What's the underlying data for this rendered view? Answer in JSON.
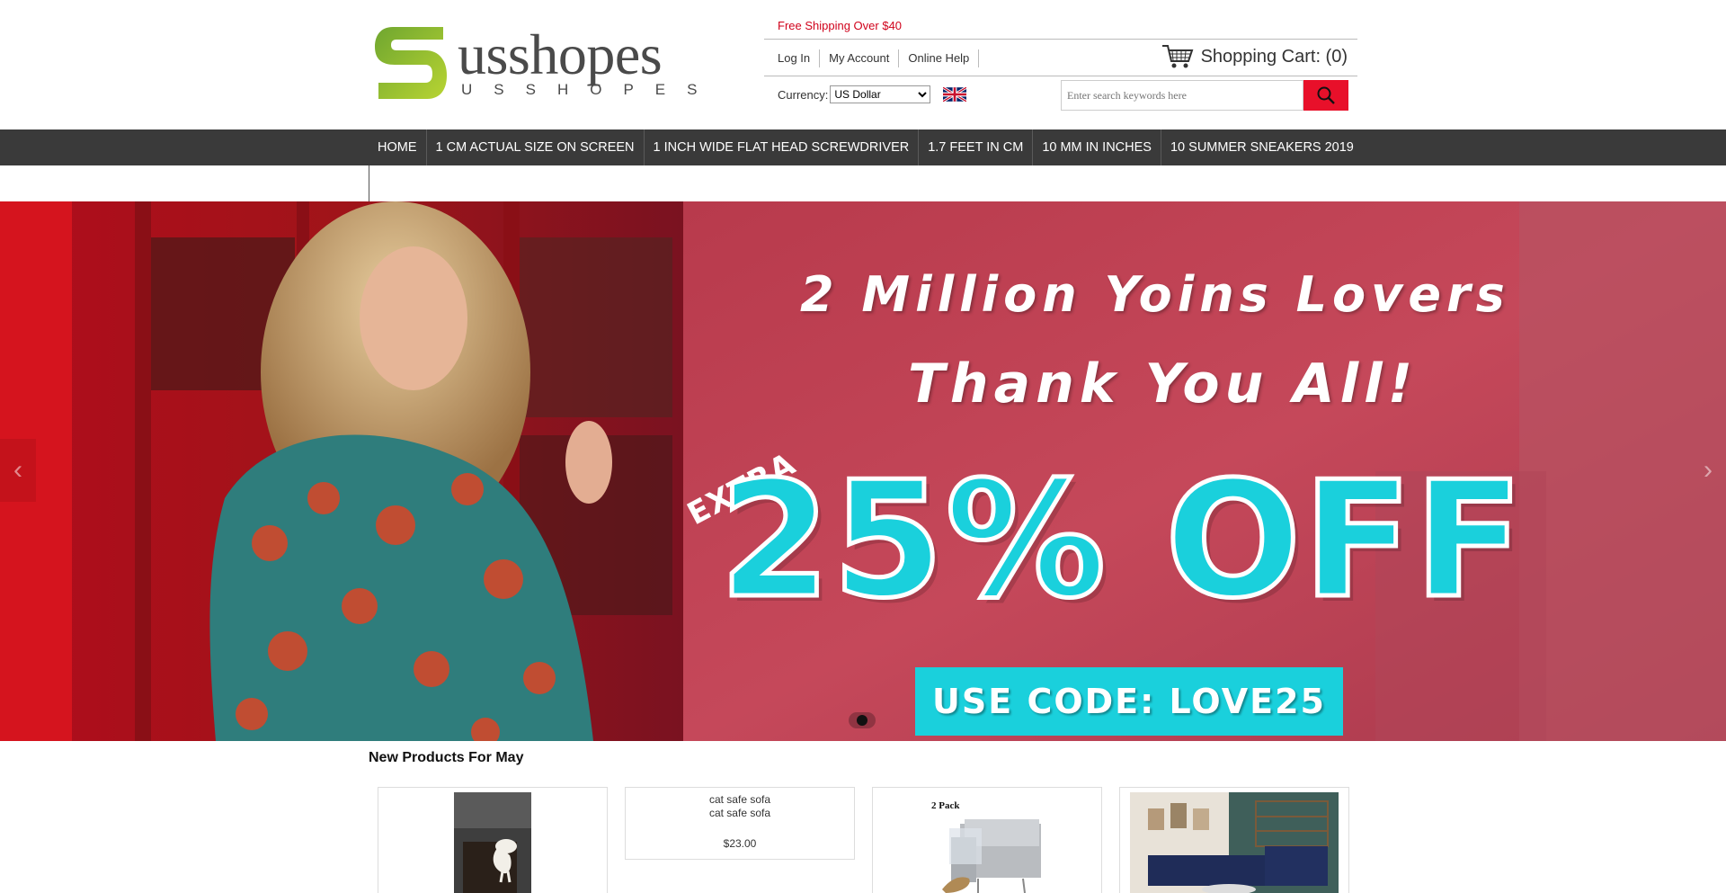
{
  "header": {
    "logo": {
      "letter": "S",
      "name": "usshopes",
      "sub": "USSHOPES"
    },
    "promo": "Free Shipping Over $40",
    "account_links": [
      "Log In",
      "My Account",
      "Online Help"
    ],
    "cart_label": "Shopping Cart: (0)",
    "currency_label": "Currency:",
    "currency_selected": "US Dollar",
    "search_placeholder": "Enter search keywords here",
    "icons": {
      "cart": "cart-icon",
      "search": "search-icon",
      "flag": "uk-flag-icon"
    },
    "colors": {
      "accent_red": "#e8102a",
      "promo_red": "#d0021b",
      "logo_green": "#8dc63f"
    }
  },
  "nav": {
    "items": [
      "HOME",
      "1 CM ACTUAL SIZE ON SCREEN",
      "1 INCH WIDE FLAT HEAD SCREWDRIVER",
      "1.7 FEET IN CM",
      "10 MM IN INCHES",
      "10 SUMMER SNEAKERS 2019"
    ],
    "background": "#3a3a3a"
  },
  "banner": {
    "line1": "2 Million Yoins Lovers",
    "line2": "Thank You All!",
    "extra": "EXTRA",
    "discount": "25% OFF",
    "code": "USE CODE: LOVE25",
    "colors": {
      "primary": "#c8102e",
      "cyan": "#1ad0dc"
    }
  },
  "products_section": {
    "title": "New Products For May",
    "items": [
      {
        "alt": "",
        "name": "",
        "price": ""
      },
      {
        "alt": "cat safe sofa",
        "name": "cat safe sofa",
        "price": "$23.00"
      },
      {
        "alt": "",
        "name": "",
        "price": "",
        "badge": "2 Pack"
      },
      {
        "alt": "",
        "name": "",
        "price": ""
      }
    ]
  }
}
